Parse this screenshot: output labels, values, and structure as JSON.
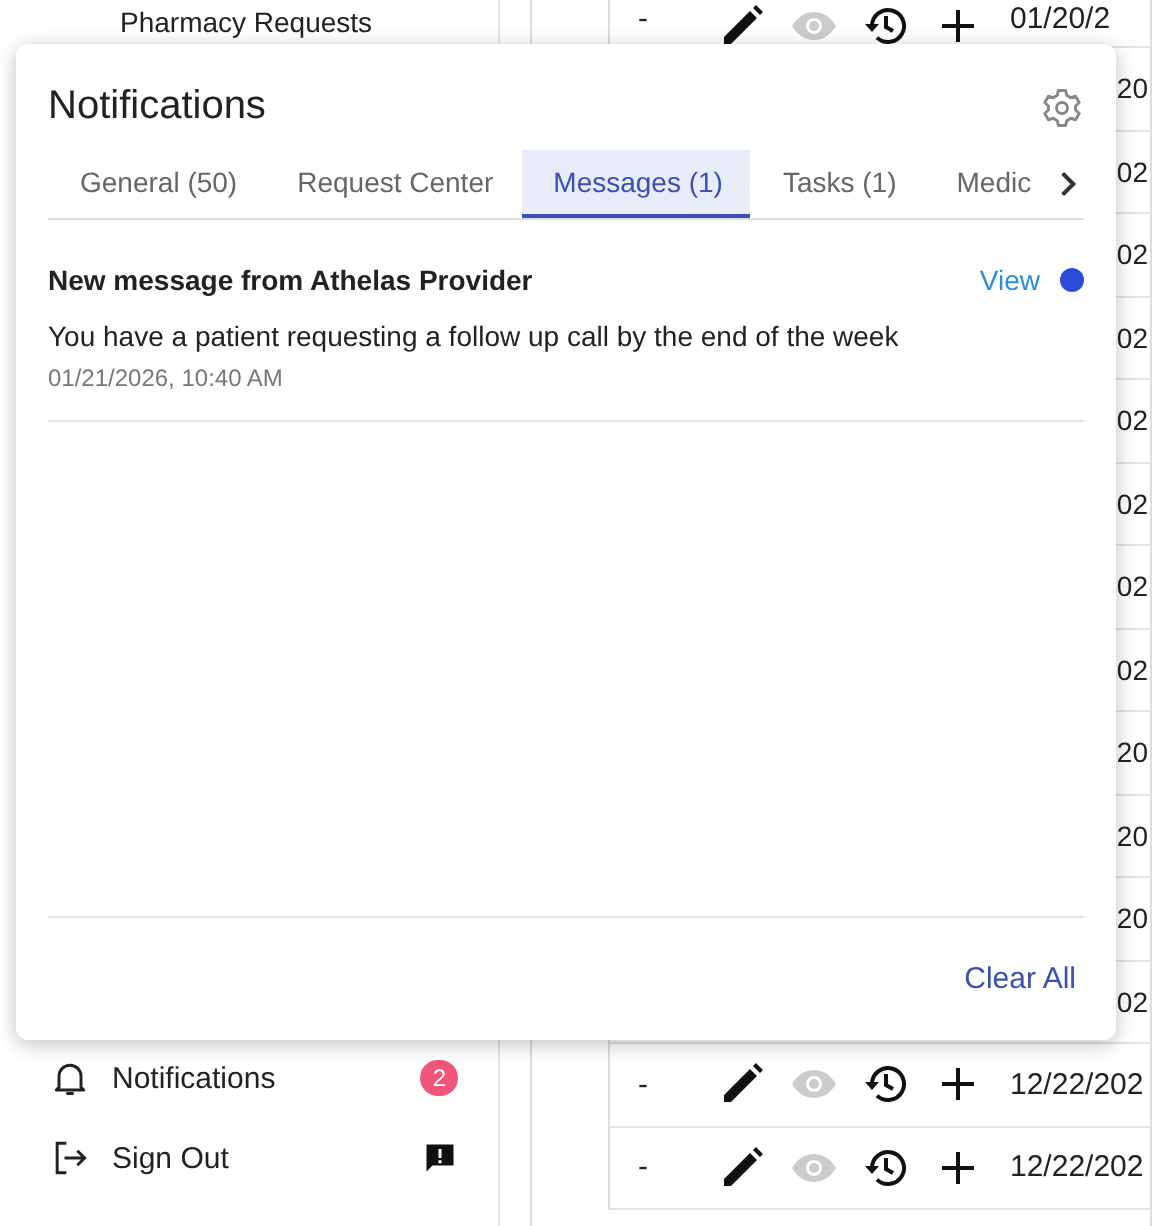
{
  "sidebar": {
    "partial_item": "Pharmacy Requests",
    "items": [
      {
        "kind": "notifications",
        "label": "Notifications",
        "badge": "2"
      },
      {
        "kind": "sign_out",
        "label": "Sign Out"
      }
    ]
  },
  "table": {
    "rows": [
      {
        "kind": "full",
        "dash": "-",
        "date": "01/20/2"
      },
      {
        "kind": "fragment",
        "date": "20"
      },
      {
        "kind": "fragment",
        "date": "02"
      },
      {
        "kind": "fragment",
        "date": "02"
      },
      {
        "kind": "fragment",
        "date": "02"
      },
      {
        "kind": "fragment",
        "date": "02"
      },
      {
        "kind": "fragment",
        "date": "02"
      },
      {
        "kind": "fragment",
        "date": "02"
      },
      {
        "kind": "fragment",
        "date": "02"
      },
      {
        "kind": "fragment",
        "date": "20"
      },
      {
        "kind": "fragment",
        "date": "20"
      },
      {
        "kind": "fragment",
        "date": "20"
      },
      {
        "kind": "fragment",
        "date": "02"
      },
      {
        "kind": "full",
        "dash": "-",
        "date": "12/22/202"
      },
      {
        "kind": "full",
        "dash": "-",
        "date": "12/22/202"
      }
    ]
  },
  "notifications": {
    "title": "Notifications",
    "tabs": [
      {
        "label": "General (50)",
        "selected": false
      },
      {
        "label": "Request Center",
        "selected": false
      },
      {
        "label": "Messages (1)",
        "selected": true
      },
      {
        "label": "Tasks (1)",
        "selected": false
      },
      {
        "label": "Medic",
        "selected": false
      }
    ],
    "items": [
      {
        "title": "New message from Athelas Provider",
        "action": "View",
        "unread": true,
        "body": "You have a patient requesting a follow up call by the end of the week",
        "time": "01/21/2026, 10:40 AM"
      }
    ],
    "clear_all": "Clear All"
  }
}
